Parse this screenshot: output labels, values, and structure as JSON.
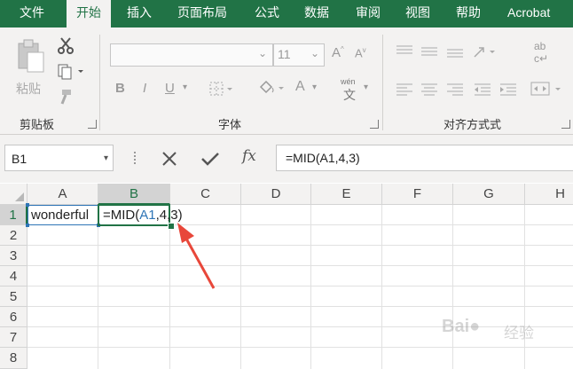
{
  "ribbon_tabs": [
    "文件",
    "开始",
    "插入",
    "页面布局",
    "公式",
    "数据",
    "审阅",
    "视图",
    "帮助",
    "Acrobat"
  ],
  "clipboard": {
    "paste_label": "粘贴",
    "group_label": "剪贴板"
  },
  "font": {
    "size": "11",
    "group_label": "字体",
    "bold": "B",
    "italic": "I",
    "underline": "U",
    "wen": "wén",
    "font_color": "A"
  },
  "alignment": {
    "group_label": "对齐方式式"
  },
  "formula_bar": {
    "name_box": "B1",
    "fx": "fx",
    "formula": "=MID(A1,4,3)"
  },
  "columns": [
    "A",
    "B",
    "C",
    "D",
    "E",
    "F",
    "G",
    "H"
  ],
  "rows": [
    "1",
    "2",
    "3",
    "4",
    "5",
    "6",
    "7",
    "8"
  ],
  "cells": {
    "A1": "wonderful",
    "B1_prefix": "=MID(",
    "B1_ref": "A1",
    "B1_suffix": ",4,3)"
  },
  "colors": {
    "brand": "#217346",
    "ref_blue": "#2e75b6",
    "arrow": "#e8473a"
  }
}
